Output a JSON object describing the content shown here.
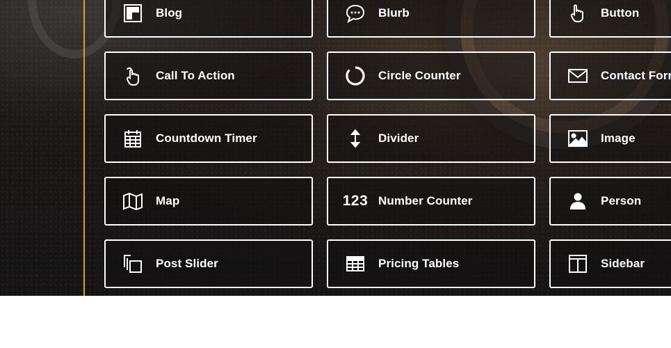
{
  "modules": [
    {
      "label": "Blog",
      "icon": "blog-icon"
    },
    {
      "label": "Blurb",
      "icon": "speech-bubble-icon"
    },
    {
      "label": "Button",
      "icon": "pointer-hand-icon"
    },
    {
      "label": "Call To Action",
      "icon": "tap-hand-icon"
    },
    {
      "label": "Circle Counter",
      "icon": "circle-counter-icon"
    },
    {
      "label": "Contact Form",
      "icon": "envelope-icon"
    },
    {
      "label": "Countdown Timer",
      "icon": "calendar-icon"
    },
    {
      "label": "Divider",
      "icon": "vertical-arrows-icon"
    },
    {
      "label": "Image",
      "icon": "image-icon"
    },
    {
      "label": "Map",
      "icon": "map-icon"
    },
    {
      "label": "Number Counter",
      "icon": "number-icon",
      "icon_text": "123"
    },
    {
      "label": "Person",
      "icon": "person-icon"
    },
    {
      "label": "Post Slider",
      "icon": "slides-icon"
    },
    {
      "label": "Pricing Tables",
      "icon": "table-icon"
    },
    {
      "label": "Sidebar",
      "icon": "sidebar-icon"
    }
  ],
  "colors": {
    "accent_line": "#d6a51c",
    "tile_border": "#ffffff",
    "text": "#ffffff"
  }
}
